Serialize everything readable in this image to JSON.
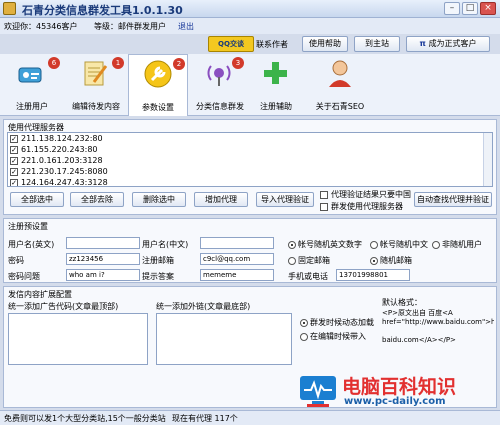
{
  "window": {
    "title": "石青分类信息群发工具1.0.1.30",
    "min": "–",
    "max": "□",
    "close": "×"
  },
  "userbar": {
    "welcome": "欢迎你：45346客户",
    "level": "等级：邮件群发用户",
    "logout": "退出"
  },
  "topbuttons": {
    "qq": "QQ交谈",
    "contact": "联系作者",
    "help": "使用帮助",
    "site": "到主站",
    "upgrade": "成为正式客户"
  },
  "tools": [
    {
      "label": "注册用户",
      "badge": "6"
    },
    {
      "label": "编辑待发内容",
      "badge": "1"
    },
    {
      "label": "参数设置",
      "badge": "2"
    },
    {
      "label": "分类信息群发",
      "badge": "3"
    },
    {
      "label": "注册辅助",
      "badge": ""
    },
    {
      "label": "关于石青SEO",
      "badge": ""
    }
  ],
  "proxy": {
    "title": "使用代理服务器",
    "items": [
      "211.138.124.232:80",
      "61.155.220.243:80",
      "221.0.161.203:3128",
      "221.230.17.245:8080",
      "124.164.247.43:3128"
    ],
    "select_all": "全部选中",
    "clear_all": "全部去除",
    "delete_selected": "删除选中",
    "add_proxy": "增加代理",
    "import_verify": "导入代理验证",
    "opt_china": "代理验证结果只要中国",
    "opt_mass": "群发使用代理服务器",
    "auto_find": "自动查找代理并验证"
  },
  "register": {
    "title": "注册预设置",
    "username_en": "用户名(英文)",
    "username_cn": "用户名(中文)",
    "rand_en": "帐号随机英文数字",
    "rand_cn": "帐号随机中文",
    "non_rand": "非随机用户",
    "password_label": "密码",
    "password_value": "zz123456",
    "email_label": "注册邮箱",
    "email_value": "c9cl@qq.com",
    "fixed_email": "固定邮箱",
    "random_email": "随机邮箱",
    "question_label": "密码问题",
    "question_value": "who am i?",
    "answer_label": "提示答案",
    "answer_value": "mememe",
    "phone_label": "手机或电话",
    "phone_value": "13701998801"
  },
  "content": {
    "title": "发信内容扩展配置",
    "ad_code": "统一添加广告代码(文章最顶部)",
    "ext_link": "统一添加外链(文章最底部)",
    "auto_add": "群发时候动态加载",
    "edit_add": "在编辑时候带入",
    "format_title": "默认格式：",
    "format_l1": "<P>原文出自 百度<A",
    "format_l2": "href=\"http://www.baidu.com\">http://w",
    "format_l3": "baidu.com</A></P>"
  },
  "status": {
    "left": "免费则可以发1个大型分类站,15个一般分类站",
    "right": "现在有代理 117个"
  },
  "watermark": {
    "name": "电脑百科知识",
    "url": "www.pc-daily.com"
  }
}
